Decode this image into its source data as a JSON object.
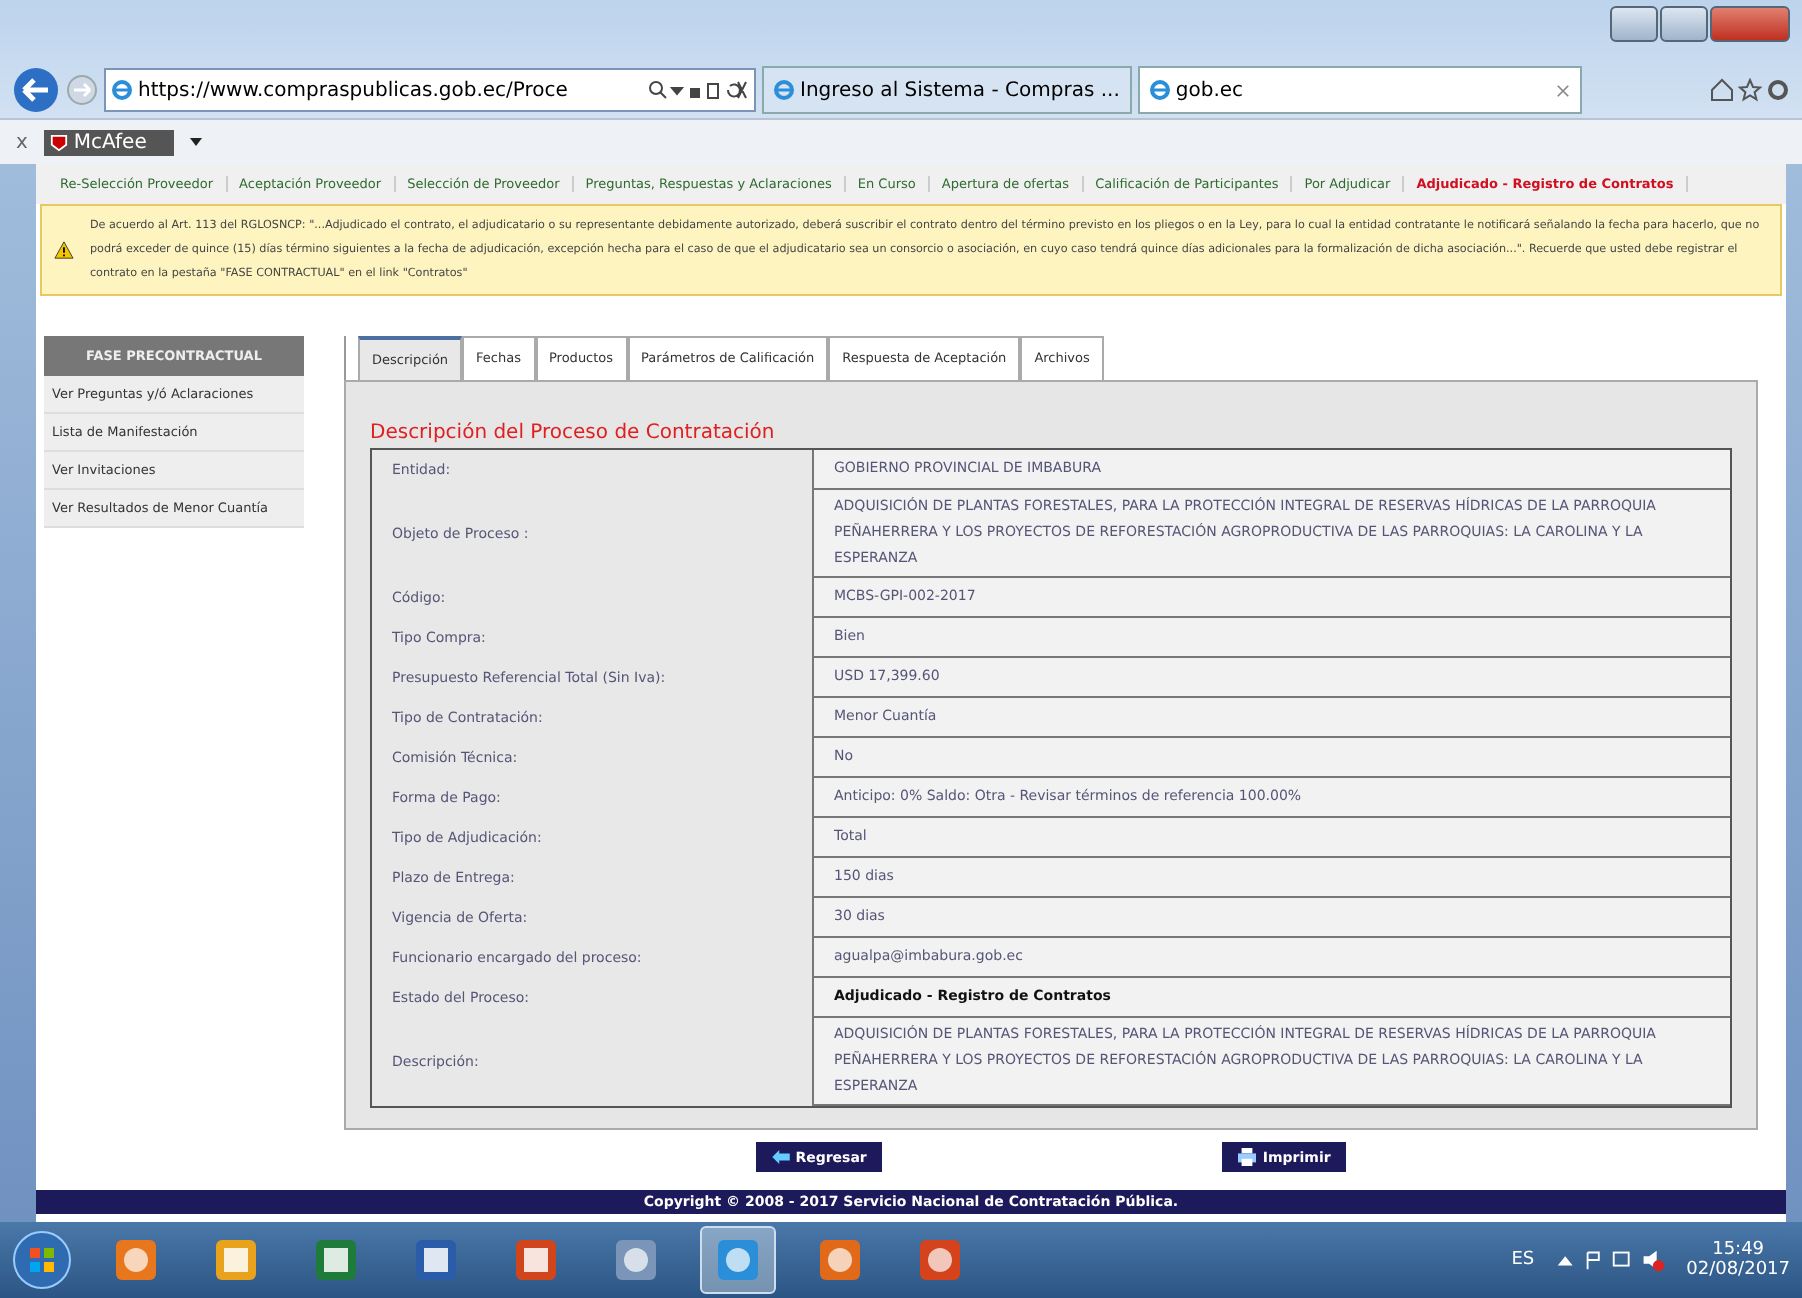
{
  "browser": {
    "address": "https://www.compraspublicas.gob.ec/Proce",
    "tabs": [
      {
        "label": "Ingreso al Sistema - Compras ...",
        "selected": false
      },
      {
        "label": "gob.ec",
        "selected": true
      }
    ],
    "toolbar_label": "McAfee",
    "close_mark": "x"
  },
  "breadcrumb": [
    {
      "label": "Re-Selección Proveedor",
      "selected": false
    },
    {
      "label": "Aceptación Proveedor",
      "selected": false
    },
    {
      "label": "Selección de Proveedor",
      "selected": false
    },
    {
      "label": "Preguntas, Respuestas y Aclaraciones",
      "selected": false
    },
    {
      "label": "En Curso",
      "selected": false
    },
    {
      "label": "Apertura de ofertas",
      "selected": false
    },
    {
      "label": "Calificación de Participantes",
      "selected": false
    },
    {
      "label": "Por Adjudicar",
      "selected": false
    },
    {
      "label": "Adjudicado - Registro de Contratos",
      "selected": true
    }
  ],
  "warning": "De acuerdo al Art. 113 del RGLOSNCP: \"...Adjudicado el contrato, el adjudicatario o su representante debidamente autorizado, deberá suscribir el contrato dentro del término previsto en los pliegos o en la Ley, para lo cual la entidad contratante le notificará señalando la fecha para hacerlo, que no podrá exceder de quince (15) días término siguientes a la fecha de adjudicación, excepción hecha para el caso de que el adjudicatario sea un consorcio o asociación, en cuyo caso tendrá quince días adicionales para la formalización de dicha asociación...\". Recuerde que usted debe registrar el contrato en la pestaña \"FASE CONTRACTUAL\" en el link \"Contratos\"",
  "sidebar": {
    "header": "FASE PRECONTRACTUAL",
    "items": [
      "Ver Preguntas y/ó Aclaraciones",
      "Lista de Manifestación",
      "Ver Invitaciones",
      "Ver Resultados de Menor Cuantía"
    ]
  },
  "tabs": [
    {
      "label": "Descripción",
      "selected": true
    },
    {
      "label": "Fechas",
      "selected": false
    },
    {
      "label": "Productos",
      "selected": false
    },
    {
      "label": "Parámetros de Calificación",
      "selected": false
    },
    {
      "label": "Respuesta de Aceptación",
      "selected": false
    },
    {
      "label": "Archivos",
      "selected": false
    }
  ],
  "section_title": "Descripción del Proceso de Contratación",
  "details": [
    {
      "label": "Entidad:",
      "value": "GOBIERNO PROVINCIAL DE IMBABURA",
      "bold": false
    },
    {
      "label": "Objeto de Proceso :",
      "value": "ADQUISICIÓN DE PLANTAS FORESTALES, PARA LA PROTECCIÓN INTEGRAL DE RESERVAS HÍDRICAS DE LA PARROQUIA PEÑAHERRERA Y LOS PROYECTOS DE REFORESTACIÓN AGROPRODUCTIVA DE LAS PARROQUIAS: LA CAROLINA Y LA ESPERANZA",
      "bold": false
    },
    {
      "label": "Código:",
      "value": "MCBS-GPI-002-2017",
      "bold": false
    },
    {
      "label": "Tipo Compra:",
      "value": "Bien",
      "bold": false
    },
    {
      "label": "Presupuesto Referencial Total (Sin Iva):",
      "value": "USD 17,399.60",
      "bold": false
    },
    {
      "label": "Tipo de Contratación:",
      "value": "Menor Cuantía",
      "bold": false
    },
    {
      "label": "Comisión Técnica:",
      "value": "No",
      "bold": false
    },
    {
      "label": "Forma de Pago:",
      "value": "Anticipo: 0% Saldo: Otra - Revisar términos de referencia 100.00%",
      "bold": false
    },
    {
      "label": "Tipo de Adjudicación:",
      "value": "Total",
      "bold": false
    },
    {
      "label": "Plazo de Entrega:",
      "value": "150 dias",
      "bold": false
    },
    {
      "label": "Vigencia de Oferta:",
      "value": "30 dias",
      "bold": false
    },
    {
      "label": "Funcionario encargado del proceso:",
      "value": "agualpa@imbabura.gob.ec",
      "bold": false
    },
    {
      "label": "Estado del Proceso:",
      "value": "Adjudicado - Registro de Contratos",
      "bold": true
    },
    {
      "label": "Descripción:",
      "value": "ADQUISICIÓN DE PLANTAS FORESTALES, PARA LA PROTECCIÓN INTEGRAL DE RESERVAS HÍDRICAS DE LA PARROQUIA PEÑAHERRERA Y LOS PROYECTOS DE REFORESTACIÓN AGROPRODUCTIVA DE LAS PARROQUIAS: LA CAROLINA Y LA ESPERANZA",
      "bold": false
    }
  ],
  "buttons": [
    {
      "label": "Regresar",
      "kind": "back"
    },
    {
      "label": "Imprimir",
      "kind": "print"
    }
  ],
  "footer": "Copyright © 2008 - 2017 Servicio Nacional de Contratación Pública.",
  "taskbar": {
    "apps": [
      {
        "kind": "media",
        "selected": false
      },
      {
        "kind": "outlook",
        "selected": false
      },
      {
        "kind": "excel",
        "selected": false
      },
      {
        "kind": "word",
        "selected": false
      },
      {
        "kind": "powerpoint",
        "selected": false
      },
      {
        "kind": "notepad",
        "selected": false
      },
      {
        "kind": "browser",
        "selected": true
      },
      {
        "kind": "firefox",
        "selected": false
      },
      {
        "kind": "document",
        "selected": false
      }
    ],
    "language": "ES",
    "time": "15:49",
    "date": "02/08/2017"
  }
}
